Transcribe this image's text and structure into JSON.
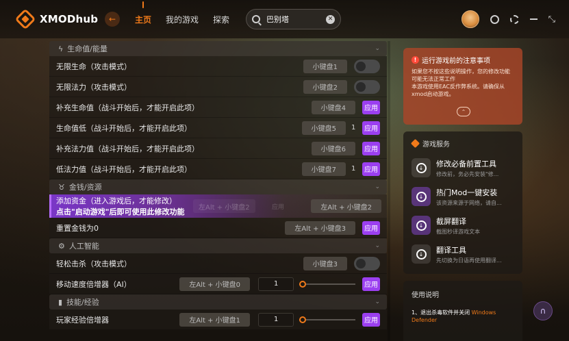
{
  "app": {
    "name": "XMODhub"
  },
  "nav": {
    "home": "主页",
    "my_games": "我的游戏",
    "explore": "探索"
  },
  "search": {
    "value": "巴别塔"
  },
  "sections": {
    "health": "生命值/能量",
    "money": "金钱/资源",
    "ai": "人工智能",
    "skills": "技能/经验"
  },
  "rows": [
    {
      "label": "无限生命（攻击模式）",
      "hotkey": "小键盘1"
    },
    {
      "label": "无限法力（攻击模式）",
      "hotkey": "小键盘2"
    },
    {
      "label": "补充生命值（战斗开始后，才能开启此项）",
      "hotkey": "小键盘4",
      "apply": "应用"
    },
    {
      "label": "生命值低（战斗开始后，才能开启此项）",
      "hotkey": "小键盘5",
      "value": "1",
      "apply": "应用"
    },
    {
      "label": "补充法力值（战斗开始后，才能开启此项）",
      "hotkey": "小键盘6",
      "apply": "应用"
    },
    {
      "label": "低法力值（战斗开始后，才能开启此项）",
      "hotkey": "小键盘7",
      "value": "1",
      "apply": "应用"
    }
  ],
  "money_rows": {
    "add_money": {
      "label": "添加资金（进入游戏后，才能修改）",
      "hint": "点击\"启动游戏\"后即可使用此修改功能",
      "ghost_hotkey": "左Alt + 小键盘2",
      "ghost_small": "应用",
      "hotkey": "左Alt + 小键盘2"
    },
    "reset_money": {
      "label": "重置金钱为0",
      "hotkey": "左Alt + 小键盘3",
      "apply": "应用"
    }
  },
  "ai_rows": {
    "easy_kill": {
      "label": "轻松击杀（攻击模式）",
      "hotkey": "小键盘3"
    },
    "move_speed": {
      "label": "移动速度倍增器（AI）",
      "hotkey": "左Alt + 小键盘0",
      "value": "1",
      "apply": "应用"
    }
  },
  "skill_rows": {
    "player_exp": {
      "label": "玩家经验倍增器",
      "hotkey": "左Alt + 小键盘1",
      "value": "1",
      "apply": "应用"
    }
  },
  "notice": {
    "title": "运行游戏前的注意事项",
    "body1": "如果您不按这些说明操作，您的修改功能可能无法正常工作",
    "body2": "本游戏使用EAC反作弊系统。请确保从xmod启动游戏。"
  },
  "services": {
    "title": "游戏服务",
    "items": [
      {
        "name": "修改必备前置工具",
        "desc": "修改前，务必先安装\"修..."
      },
      {
        "name": "热门Mod一键安装",
        "desc": "该资源来源于网络，请自..."
      },
      {
        "name": "截屏翻译",
        "desc": "截图秒译游戏文本"
      },
      {
        "name": "翻译工具",
        "desc": "先切换为日语再使用翻译..."
      }
    ]
  },
  "usage": {
    "title": "使用说明",
    "step1_prefix": "1、退出杀毒软件并关闭",
    "step1_accent": "Windows Defender"
  },
  "colors": {
    "accent": "#f07a1a",
    "apply": "#9b3ff0",
    "notice_bg": "#aa4628"
  }
}
